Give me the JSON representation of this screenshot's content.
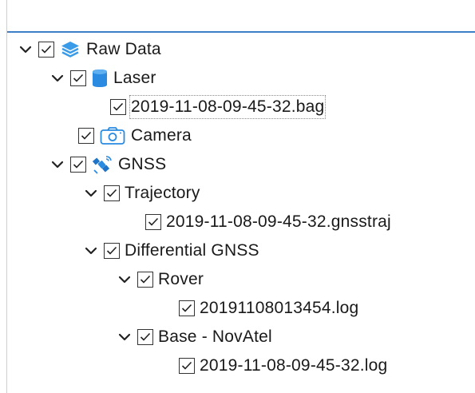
{
  "tree": {
    "raw_data": {
      "label": "Raw Data",
      "expanded": true,
      "checked": true,
      "icon": "layers-icon"
    },
    "laser": {
      "label": "Laser",
      "expanded": true,
      "checked": true,
      "icon": "database-icon"
    },
    "laser_file": {
      "label": "2019-11-08-09-45-32.bag",
      "checked": true,
      "selected": true
    },
    "camera": {
      "label": "Camera",
      "checked": true,
      "icon": "camera-icon"
    },
    "gnss": {
      "label": "GNSS",
      "expanded": true,
      "checked": true,
      "icon": "satellite-icon"
    },
    "trajectory": {
      "label": "Trajectory",
      "expanded": true,
      "checked": true
    },
    "trajectory_file": {
      "label": "2019-11-08-09-45-32.gnsstraj",
      "checked": true
    },
    "differential_gnss": {
      "label": "Differential GNSS",
      "expanded": true,
      "checked": true
    },
    "rover": {
      "label": "Rover",
      "expanded": true,
      "checked": true
    },
    "rover_file": {
      "label": "20191108013454.log",
      "checked": true
    },
    "base": {
      "label": "Base - NovAtel",
      "expanded": true,
      "checked": true
    },
    "base_file": {
      "label": "2019-11-08-09-45-32.log",
      "checked": true
    }
  },
  "colors": {
    "accent": "#3c7fc6",
    "icon_blue": "#2a8be0",
    "border": "#cfcfcf"
  }
}
